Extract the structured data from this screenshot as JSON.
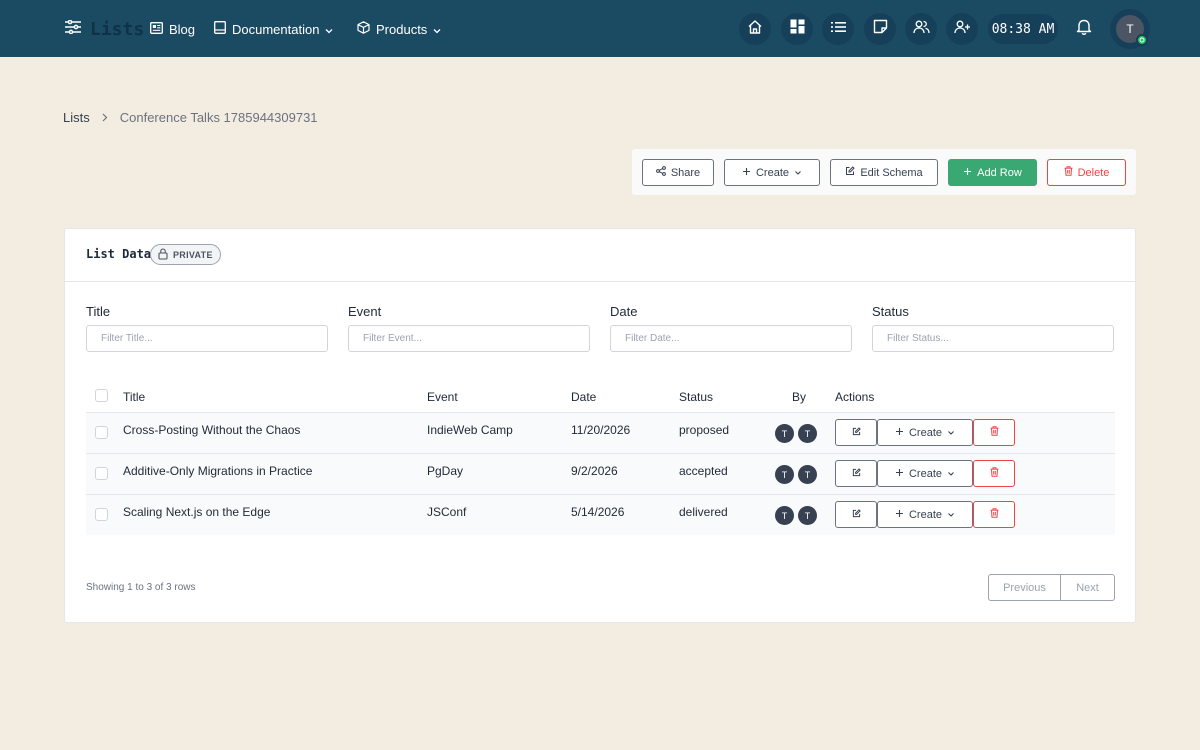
{
  "header": {
    "brand": "Lists",
    "nav": [
      {
        "label": "Blog",
        "icon": "newspaper-icon"
      },
      {
        "label": "Documentation",
        "icon": "book-icon"
      },
      {
        "label": "Products",
        "icon": "box-icon"
      }
    ],
    "icons": [
      "home-icon",
      "dashboard-icon",
      "list-icon",
      "note-icon",
      "users-icon",
      "user-plus-icon"
    ],
    "clock": "08:38 AM",
    "avatar_initial": "T",
    "colors": {
      "bar": "#1b4a63",
      "pill": "#164059"
    }
  },
  "breadcrumb": {
    "root": "Lists",
    "current": "Conference Talks 1785944309731"
  },
  "toolbar": {
    "share": "Share",
    "create": "Create",
    "edit_schema": "Edit Schema",
    "add_row": "Add Row",
    "delete": "Delete",
    "colors": {
      "add": "#3aa873",
      "delete": "#ef4444"
    }
  },
  "card": {
    "title": "List Data",
    "badge": "PRIVATE"
  },
  "filters": [
    {
      "label": "Title",
      "placeholder": "Filter Title..."
    },
    {
      "label": "Event",
      "placeholder": "Filter Event..."
    },
    {
      "label": "Date",
      "placeholder": "Filter Date..."
    },
    {
      "label": "Status",
      "placeholder": "Filter Status..."
    }
  ],
  "table": {
    "headers": {
      "title": "Title",
      "event": "Event",
      "date": "Date",
      "status": "Status",
      "by": "By",
      "actions": "Actions"
    },
    "rows": [
      {
        "title": "Cross-Posting Without the Chaos",
        "event": "IndieWeb Camp",
        "date": "11/20/2026",
        "status": "proposed",
        "by": [
          "T",
          "T"
        ],
        "create": "Create"
      },
      {
        "title": "Additive-Only Migrations in Practice",
        "event": "PgDay",
        "date": "9/2/2026",
        "status": "accepted",
        "by": [
          "T",
          "T"
        ],
        "create": "Create"
      },
      {
        "title": "Scaling Next.js on the Edge",
        "event": "JSConf",
        "date": "5/14/2026",
        "status": "delivered",
        "by": [
          "T",
          "T"
        ],
        "create": "Create"
      }
    ]
  },
  "footer": {
    "showing": "Showing 1 to 3 of 3 rows",
    "previous": "Previous",
    "next": "Next"
  }
}
